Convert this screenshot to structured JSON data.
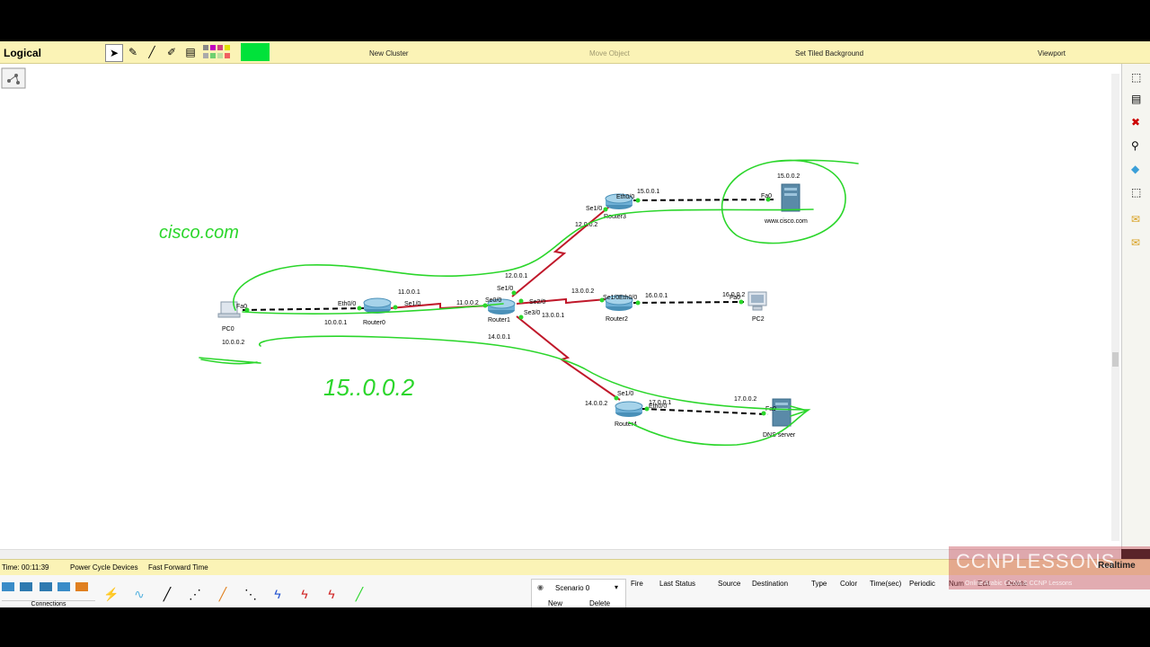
{
  "toolbar": {
    "mode_label": "Logical",
    "new_cluster": "New Cluster",
    "move_object": "Move Object",
    "set_tiled_background": "Set Tiled Background",
    "viewport": "Viewport",
    "active_color": "#00e23a"
  },
  "devices": {
    "pc0": {
      "name": "PC0",
      "fa0": "Fa0",
      "ip": "10.0.0.2"
    },
    "router0": {
      "name": "Router0",
      "eth": "Eth0/0",
      "eth_ip": "10.0.0.1",
      "se": "Se1/0",
      "se_ip": "11.0.0.1"
    },
    "router1": {
      "name": "Router1",
      "se00": "Se0/0",
      "se00_ip": "11.0.0.2",
      "se10": "Se1/0",
      "se10_ip": "12.0.0.1",
      "se20": "Se2/0",
      "se20_ip": "13.0.0.1",
      "se30": "Se3/0",
      "se30_ip": "14.0.0.1"
    },
    "router2": {
      "name": "Router2",
      "se": "Se1/0",
      "se_ip": "13.0.0.2",
      "eth": "Eth0/0",
      "eth_ip": "16.0.0.1"
    },
    "router3": {
      "name": "Router3",
      "se": "Se1/0",
      "se_ip": "12.0.0.2",
      "eth": "Eth0/0",
      "eth_ip": "15.0.0.1"
    },
    "router4": {
      "name": "Router4",
      "se": "Se1/0",
      "se_ip": "14.0.0.2",
      "eth": "Eth0/0",
      "eth_ip": "17.0.0.1"
    },
    "pc2": {
      "name": "PC2",
      "fa0": "Fa0",
      "ip": "16.0.0.2"
    },
    "web": {
      "name": "www.cisco.com",
      "fa0": "Fa0",
      "ip": "15.0.0.2"
    },
    "dns": {
      "name": "DNS server",
      "fa0": "Fa0",
      "ip": "17.0.0.2"
    }
  },
  "annotations": {
    "handwritten_1": "cisco.com",
    "handwritten_2": "15..0.0.2",
    "ink_color": "#2bd62b"
  },
  "status": {
    "time": "Time: 00:11:39",
    "power_cycle": "Power Cycle Devices",
    "fast_forward": "Fast Forward Time",
    "realtime": "Realtime"
  },
  "bottom": {
    "connections_label": "Connections",
    "scenario": "Scenario 0",
    "new_button": "New",
    "delete_button": "Delete",
    "pdu_columns": [
      "Fire",
      "Last Status",
      "Source",
      "Destination",
      "Type",
      "Color",
      "Time(sec)",
      "Periodic",
      "Num",
      "Edit",
      "Delete"
    ]
  },
  "watermark": {
    "title": "CCNPLESSONS",
    "subtitle": "Online Arabic CCNA & CCNP Lessons"
  }
}
